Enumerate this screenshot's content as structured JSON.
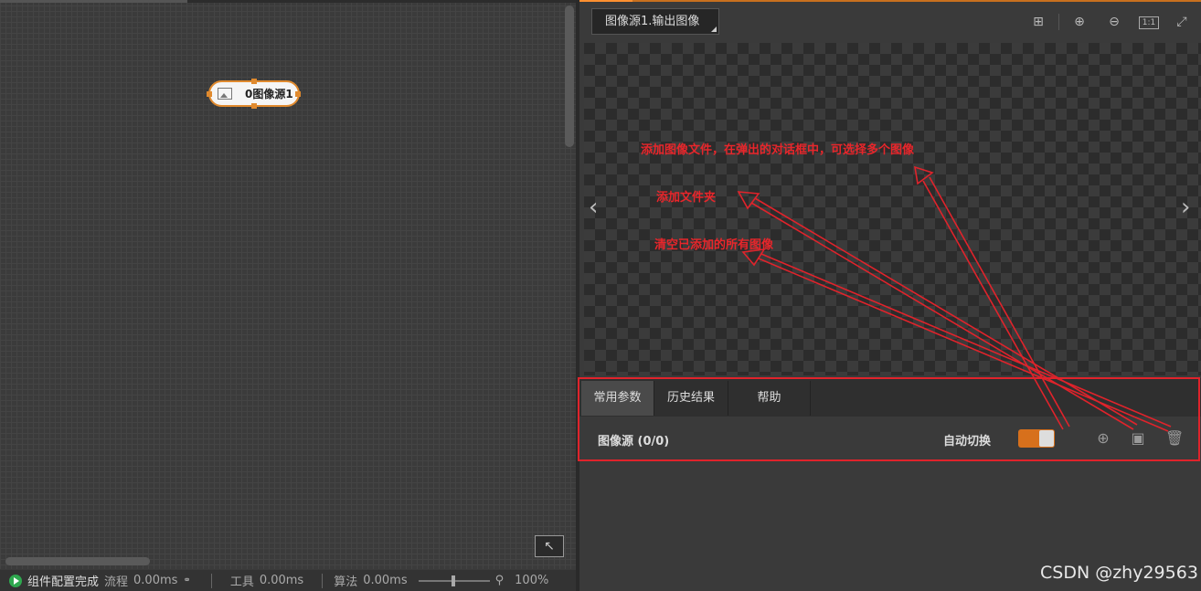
{
  "canvas": {
    "node_label": "0图像源1",
    "locate_icon": "arrow-up-left-icon"
  },
  "statusbar": {
    "status_text": "组件配置完成",
    "flow_label": "流程",
    "flow_time": "0.00ms",
    "tool_label": "工具",
    "tool_time": "0.00ms",
    "algo_label": "算法",
    "algo_time": "0.00ms",
    "zoom": "100%"
  },
  "viewer": {
    "image_select": "图像源1.输出图像",
    "toolbar_icons": [
      "crosshair-icon",
      "zoom-in-icon",
      "zoom-out-icon",
      "actual-size-icon",
      "fit-window-icon"
    ],
    "actual_size_text": "1:1",
    "prev_icon": "chevron-left-icon",
    "next_icon": "chevron-right-icon"
  },
  "annotations": {
    "add_images": "添加图像文件，在弹出的对话框中，可选择多个图像",
    "add_folder": "添加文件夹",
    "clear_all": "清空已添加的所有图像",
    "color": "#e8262b"
  },
  "tabs": [
    {
      "label": "常用参数",
      "active": true
    },
    {
      "label": "历史结果",
      "active": false
    },
    {
      "label": "帮助",
      "active": false
    }
  ],
  "params": {
    "image_source_label": "图像源 (0/0)",
    "auto_switch_label": "自动切换",
    "auto_switch_on": true,
    "add_file_icon": "plus-circle-icon",
    "add_folder_icon": "folder-plus-icon",
    "clear_icon": "trash-icon"
  },
  "watermark": "CSDN @zhy29563",
  "colors": {
    "accent": "#d7701c",
    "annotation": "#e0232b"
  }
}
